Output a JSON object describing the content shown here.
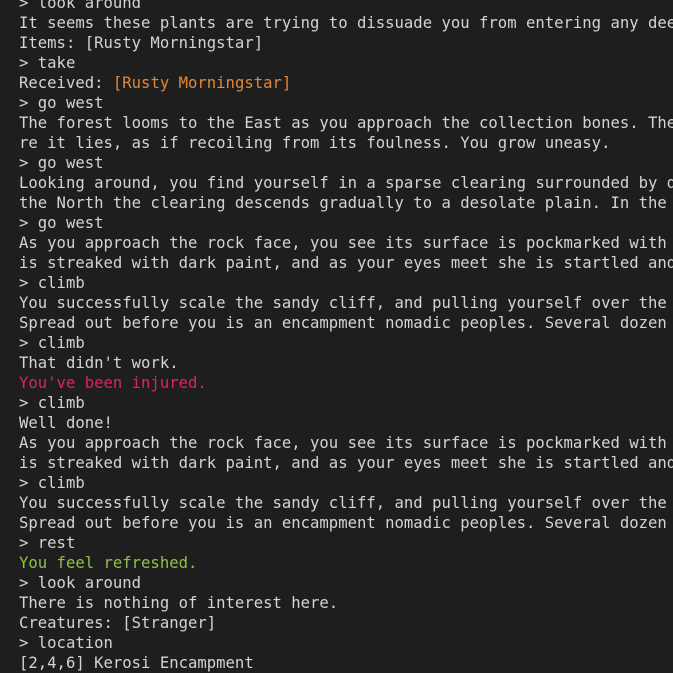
{
  "colors": {
    "background": "#1e1e1e",
    "text": "#d4d4d4",
    "item_orange": "#e0883a",
    "injury_red": "#e0245e",
    "success_green": "#8bc34a"
  },
  "terminal": {
    "lines": [
      "> look around",
      "It seems these plants are trying to dissuade you from entering any deeper",
      "Items: [Rusty Morningstar]",
      "> take",
      {
        "label": "Received: ",
        "value": "[Rusty Morningstar]"
      },
      "> go west",
      "The forest looms to the East as you approach the collection bones. The hu",
      "re it lies, as if recoiling from its foulness. You grow uneasy.",
      "> go west",
      "Looking around, you find yourself in a sparse clearing surrounded by dry",
      "the North the clearing descends gradually to a desolate plain. In the dis",
      "> go west",
      "As you approach the rock face, you see its surface is pockmarked with sma",
      "is streaked with dark paint, and as your eyes meet she is startled and wi",
      "> climb",
      "You successfully scale the sandy cliff, and pulling yourself over the lip",
      "Spread out before you is an encampment nomadic peoples. Several dozen ani",
      "> climb",
      "That didn't work.",
      "You've been injured.",
      "> climb",
      "Well done!",
      "As you approach the rock face, you see its surface is pockmarked with sma",
      "is streaked with dark paint, and as your eyes meet she is startled and wi",
      "> climb",
      "You successfully scale the sandy cliff, and pulling yourself over the lip",
      "Spread out before you is an encampment nomadic peoples. Several dozen ani",
      "> rest",
      "You feel refreshed.",
      "> look around",
      "There is nothing of interest here.",
      "Creatures: [Stranger]",
      "> location",
      "[2,4,6] Kerosi Encampment"
    ]
  }
}
